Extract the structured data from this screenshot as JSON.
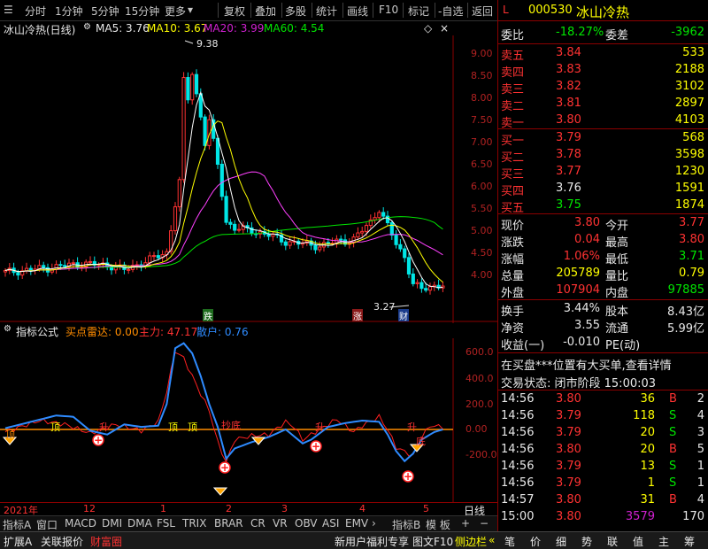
{
  "toolbar": {
    "periods": [
      "分时",
      "1分钟",
      "5分钟",
      "15分钟",
      "更多"
    ],
    "actions": [
      "复权",
      "叠加",
      "多股",
      "统计",
      "画线",
      "F10",
      "标记",
      "-自选",
      "返回"
    ]
  },
  "chart": {
    "title": "冰山冷热(日线)",
    "ma5_label": "MA5: 3.76",
    "ma10_label": "MA10: 3.67",
    "ma20_label": "MA20: 3.99",
    "ma60_label": "MA60: 4.54",
    "high_label": "9.38",
    "low_label": "3.27",
    "event_tags": [
      "跌",
      "涨",
      "财"
    ],
    "price_ticks": [
      "9.00",
      "8.50",
      "8.00",
      "7.50",
      "7.00",
      "6.50",
      "6.00",
      "5.50",
      "5.00",
      "4.50",
      "4.00"
    ],
    "colors": {
      "ma5": "#ffffff",
      "ma10": "#ffff00",
      "ma20": "#ff40ff",
      "ma60": "#00e600",
      "up": "#ff3232",
      "down": "#00e6e6"
    }
  },
  "indicator": {
    "title": "指标公式",
    "buy_label": "买点雷达: 0.00",
    "main_label": "主力: 47.17",
    "retail_label": "散户: 0.76",
    "ticks": [
      "600.0",
      "400.0",
      "200.0",
      "0.00",
      "-200.0"
    ],
    "signal_labels": [
      "顶",
      "顶",
      "顶",
      "顶",
      "抄底",
      "升",
      "升",
      "升",
      "底"
    ],
    "colors": {
      "main": "#ff2020",
      "retail": "#2e8bff",
      "zero": "#ff8c00"
    }
  },
  "timeline": {
    "labels": [
      "2021年",
      "12",
      "1",
      "2",
      "3",
      "4",
      "5"
    ],
    "right_label": "日线"
  },
  "bottom_tabs": [
    "指标A",
    "窗口",
    "MACD",
    "DMI",
    "DMA",
    "FSL",
    "TRIX",
    "BRAR",
    "CR",
    "VR",
    "OBV",
    "ASI",
    "EMV",
    "指标B",
    "模 板"
  ],
  "status_bar": {
    "left": [
      "扩展A",
      "关联报价",
      "财富圈"
    ],
    "right": [
      "新用户福利专享",
      "图文F10",
      "侧边栏"
    ],
    "icons": [
      "笔",
      "价",
      "细",
      "势",
      "联",
      "值",
      "主",
      "筹"
    ]
  },
  "quote": {
    "code": "000530",
    "name": "冰山冷热",
    "weibi_label": "委比",
    "weibi": "-18.27%",
    "weicha_label": "委差",
    "weicha": "-3962",
    "asks": [
      {
        "label": "卖五",
        "price": "3.84",
        "vol": "533"
      },
      {
        "label": "卖四",
        "price": "3.83",
        "vol": "2188"
      },
      {
        "label": "卖三",
        "price": "3.82",
        "vol": "3102"
      },
      {
        "label": "卖二",
        "price": "3.81",
        "vol": "2897"
      },
      {
        "label": "卖一",
        "price": "3.80",
        "vol": "4103"
      }
    ],
    "bids": [
      {
        "label": "买一",
        "price": "3.79",
        "vol": "568"
      },
      {
        "label": "买二",
        "price": "3.78",
        "vol": "3598"
      },
      {
        "label": "买三",
        "price": "3.77",
        "vol": "1230"
      },
      {
        "label": "买四",
        "price": "3.76",
        "vol": "1591"
      },
      {
        "label": "买五",
        "price": "3.75",
        "vol": "1874"
      }
    ],
    "stats": [
      {
        "l1": "现价",
        "v1": "3.80",
        "l2": "今开",
        "v2": "3.77"
      },
      {
        "l1": "涨跌",
        "v1": "0.04",
        "l2": "最高",
        "v2": "3.80"
      },
      {
        "l1": "涨幅",
        "v1": "1.06%",
        "l2": "最低",
        "v2": "3.71"
      },
      {
        "l1": "总量",
        "v1": "205789",
        "l2": "量比",
        "v2": "0.79"
      },
      {
        "l1": "外盘",
        "v1": "107904",
        "l2": "内盘",
        "v2": "97885"
      }
    ],
    "stats2": [
      {
        "l1": "换手",
        "v1": "3.44%",
        "l2": "股本",
        "v2": "8.43亿"
      },
      {
        "l1": "净资",
        "v1": "3.55",
        "l2": "流通",
        "v2": "5.99亿"
      },
      {
        "l1": "收益(一)",
        "v1": "-0.010",
        "l2": "PE(动)",
        "v2": ""
      }
    ],
    "notice": "在买盘***位置有大买单,查看详情",
    "trade_status": "交易状态: 闭市阶段  15:00:03",
    "ticks": [
      {
        "time": "14:56",
        "price": "3.80",
        "vol": "36",
        "side": "B",
        "n": "2"
      },
      {
        "time": "14:56",
        "price": "3.79",
        "vol": "118",
        "side": "S",
        "n": "4"
      },
      {
        "time": "14:56",
        "price": "3.79",
        "vol": "20",
        "side": "S",
        "n": "3"
      },
      {
        "time": "14:56",
        "price": "3.80",
        "vol": "20",
        "side": "B",
        "n": "5"
      },
      {
        "time": "14:56",
        "price": "3.79",
        "vol": "13",
        "side": "S",
        "n": "1"
      },
      {
        "time": "14:56",
        "price": "3.79",
        "vol": "1",
        "side": "S",
        "n": "1"
      },
      {
        "time": "14:57",
        "price": "3.80",
        "vol": "31",
        "side": "B",
        "n": "4"
      },
      {
        "time": "15:00",
        "price": "3.80",
        "vol": "3579",
        "side": "",
        "n": "170"
      }
    ]
  }
}
